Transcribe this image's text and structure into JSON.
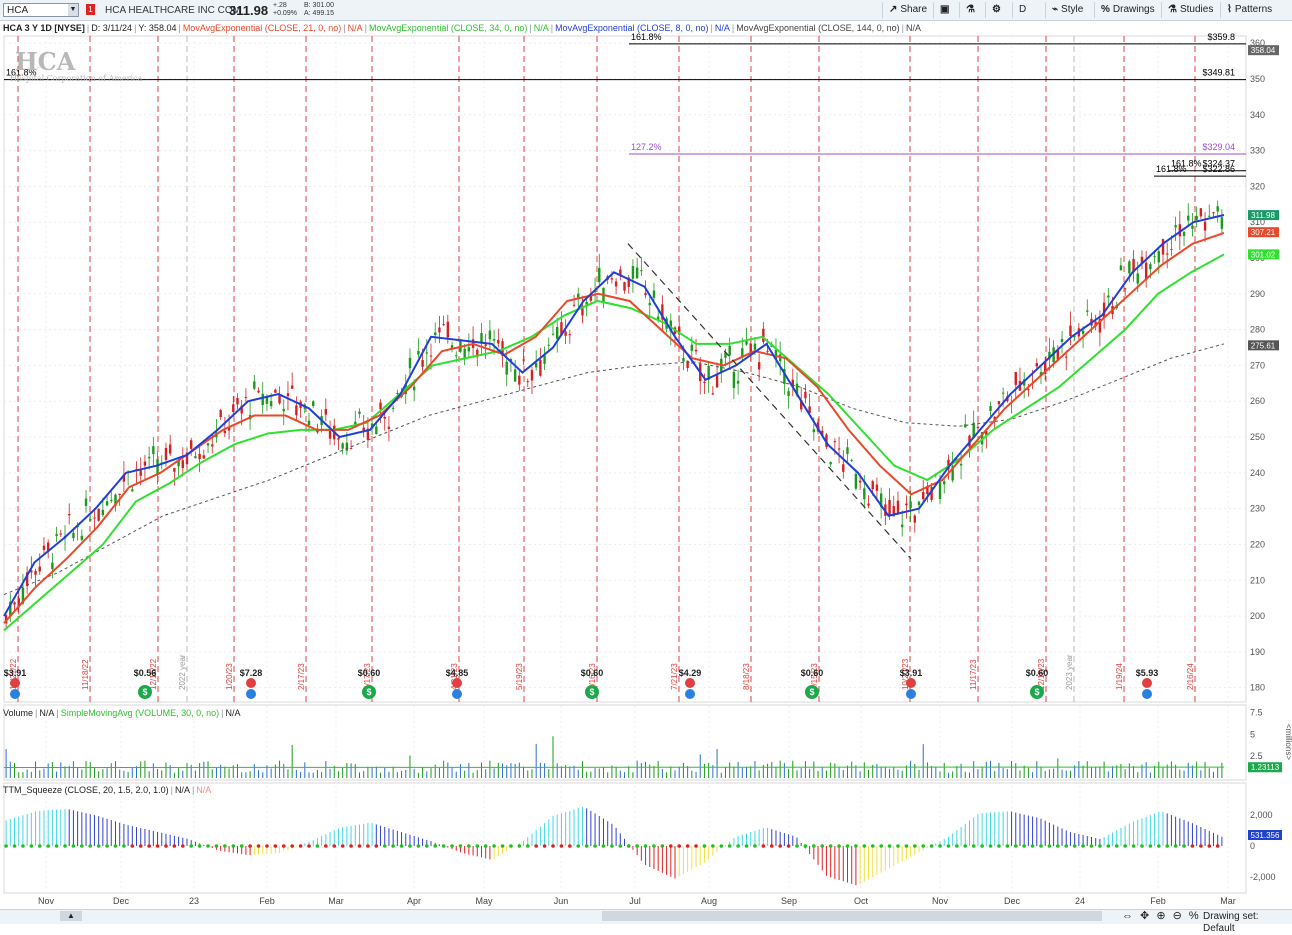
{
  "toolbar": {
    "symbol": "HCA",
    "company": "HCA HEALTHCARE INC COM",
    "last_price": "311.98",
    "change": "+.28",
    "change_pct": "+0.09%",
    "bid": "B: 301.00",
    "ask": "A: 499.15",
    "flag": "1",
    "buttons": {
      "share": "Share",
      "aggregation": "D",
      "style": "Style",
      "drawings": "Drawings",
      "studies": "Studies",
      "patterns": "Patterns"
    }
  },
  "legend": {
    "title": "HCA 3 Y 1D [NYSE]",
    "cursor_date": "D: 3/11/24",
    "cursor_y": "Y: 358.04",
    "ema21": "MovAvgExponential (CLOSE, 21, 0, no)",
    "ema34": "MovAvgExponential (CLOSE, 34, 0, no)",
    "ema8": "MovAvgExponential (CLOSE, 8, 0, no)",
    "ema144": "MovAvgExponential (CLOSE, 144, 0, no)",
    "na": "N/A"
  },
  "logo": {
    "text": "HCA",
    "sub": "Hospital Corporation of America"
  },
  "colors": {
    "ema8": "#1f3fdb",
    "ema21": "#e8492a",
    "ema34": "#2fe02f",
    "ema144": "#555555",
    "up": "#1a9a1a",
    "down": "#d42020",
    "fib_purple": "#9b4fd6"
  },
  "chart_data": {
    "type": "candlestick",
    "y_ticks": [
      180,
      190,
      200,
      210,
      220,
      230,
      240,
      250,
      260,
      270,
      280,
      290,
      300,
      310,
      320,
      330,
      340,
      350,
      360
    ],
    "ylim": [
      176,
      362
    ],
    "months": [
      "Nov",
      "Dec",
      "23",
      "Feb",
      "Mar",
      "Apr",
      "May",
      "Jun",
      "Jul",
      "Aug",
      "Sep",
      "Oct",
      "Nov",
      "Dec",
      "24",
      "Feb",
      "Mar"
    ],
    "price_tags": [
      {
        "label": "358.04",
        "value": 358.04,
        "color": "#666666"
      },
      {
        "label": "311.98",
        "value": 311.98,
        "color": "#1a9a6a"
      },
      {
        "label": "307.21",
        "value": 307.21,
        "color": "#e8492a"
      },
      {
        "label": "301.02",
        "value": 301.02,
        "color": "#2fe02f"
      },
      {
        "label": "275.61",
        "value": 275.61,
        "color": "#555555"
      }
    ],
    "fib_levels": [
      {
        "pct": "161.8%",
        "value": 359.8,
        "label": "$359.8",
        "color": "#000000"
      },
      {
        "pct": "161.8%",
        "value": 349.81,
        "label": "$349.81",
        "color": "#000000"
      },
      {
        "pct": "127.2%",
        "value": 329.04,
        "label": "$329.04",
        "color": "#9b4fd6"
      },
      {
        "pct": "161.8%",
        "value": 324.37,
        "label": "$324.37",
        "color": "#000000"
      },
      {
        "pct": "161.8%",
        "value": 322.86,
        "label": "$322.86",
        "color": "#000000"
      }
    ],
    "event_dates": [
      "10/21/22",
      "11/18/22",
      "12/16/22",
      "2022 year",
      "1/20/23",
      "2/17/23",
      "3/17/23",
      "4/21/23",
      "5/19/23",
      "6/16/23",
      "7/21/23",
      "8/18/23",
      "9/15/23",
      "10/20/23",
      "11/17/23",
      "12/15/23",
      "2023 year",
      "1/19/24",
      "2/16/24"
    ],
    "dividends": [
      "$3.91",
      "$0.56",
      "$7.28",
      "$0.60",
      "$4.85",
      "$0.60",
      "$4.29",
      "$0.60",
      "$3.91",
      "$0.60",
      "$5.93"
    ],
    "ema8": [
      200,
      215,
      222,
      230,
      240,
      242,
      245,
      252,
      260,
      262,
      258,
      250,
      252,
      262,
      278,
      277,
      276,
      268,
      275,
      288,
      296,
      292,
      278,
      266,
      270,
      276,
      262,
      248,
      240,
      228,
      230,
      242,
      252,
      262,
      270,
      278,
      284,
      296,
      304,
      310,
      312
    ],
    "ema21": [
      198,
      208,
      216,
      225,
      236,
      240,
      246,
      252,
      256,
      256,
      252,
      252,
      256,
      264,
      274,
      276,
      273,
      278,
      288,
      290,
      288,
      280,
      272,
      270,
      274,
      272,
      264,
      252,
      242,
      234,
      238,
      248,
      258,
      266,
      274,
      282,
      290,
      298,
      304,
      307
    ],
    "ema34": [
      196,
      204,
      212,
      220,
      232,
      237,
      243,
      248,
      251,
      252,
      252,
      254,
      262,
      270,
      272,
      274,
      278,
      284,
      288,
      286,
      282,
      276,
      276,
      278,
      270,
      262,
      252,
      242,
      238,
      244,
      252,
      258,
      264,
      272,
      280,
      290,
      296,
      301
    ],
    "ema144": [
      206,
      212,
      220,
      228,
      233,
      238,
      244,
      250,
      256,
      260,
      264,
      268,
      270,
      271,
      268,
      264,
      258,
      254,
      253,
      255,
      260,
      266,
      272,
      276
    ],
    "volume": {
      "y_ticks": [
        "7.5",
        "5",
        "2.5"
      ],
      "unit": "millions",
      "current": "1.23113"
    },
    "squeeze": {
      "y_ticks": [
        "2,000",
        "0",
        "-2,000"
      ],
      "current": "531.356"
    }
  },
  "volume_legend": {
    "label": "Volume",
    "na": "N/A",
    "sma": "SimpleMovingAvg (VOLUME, 30, 0, no)",
    "sma_na": "N/A"
  },
  "squeeze_legend": {
    "label": "TTM_Squeeze (CLOSE, 20, 1.5, 2.0, 1.0)",
    "na": "N/A",
    "na2": "N/A"
  },
  "bottom": {
    "drawing_set": "Drawing set: Default",
    "zoom": "⇔ ✥ ⊕ ⊖ %"
  }
}
